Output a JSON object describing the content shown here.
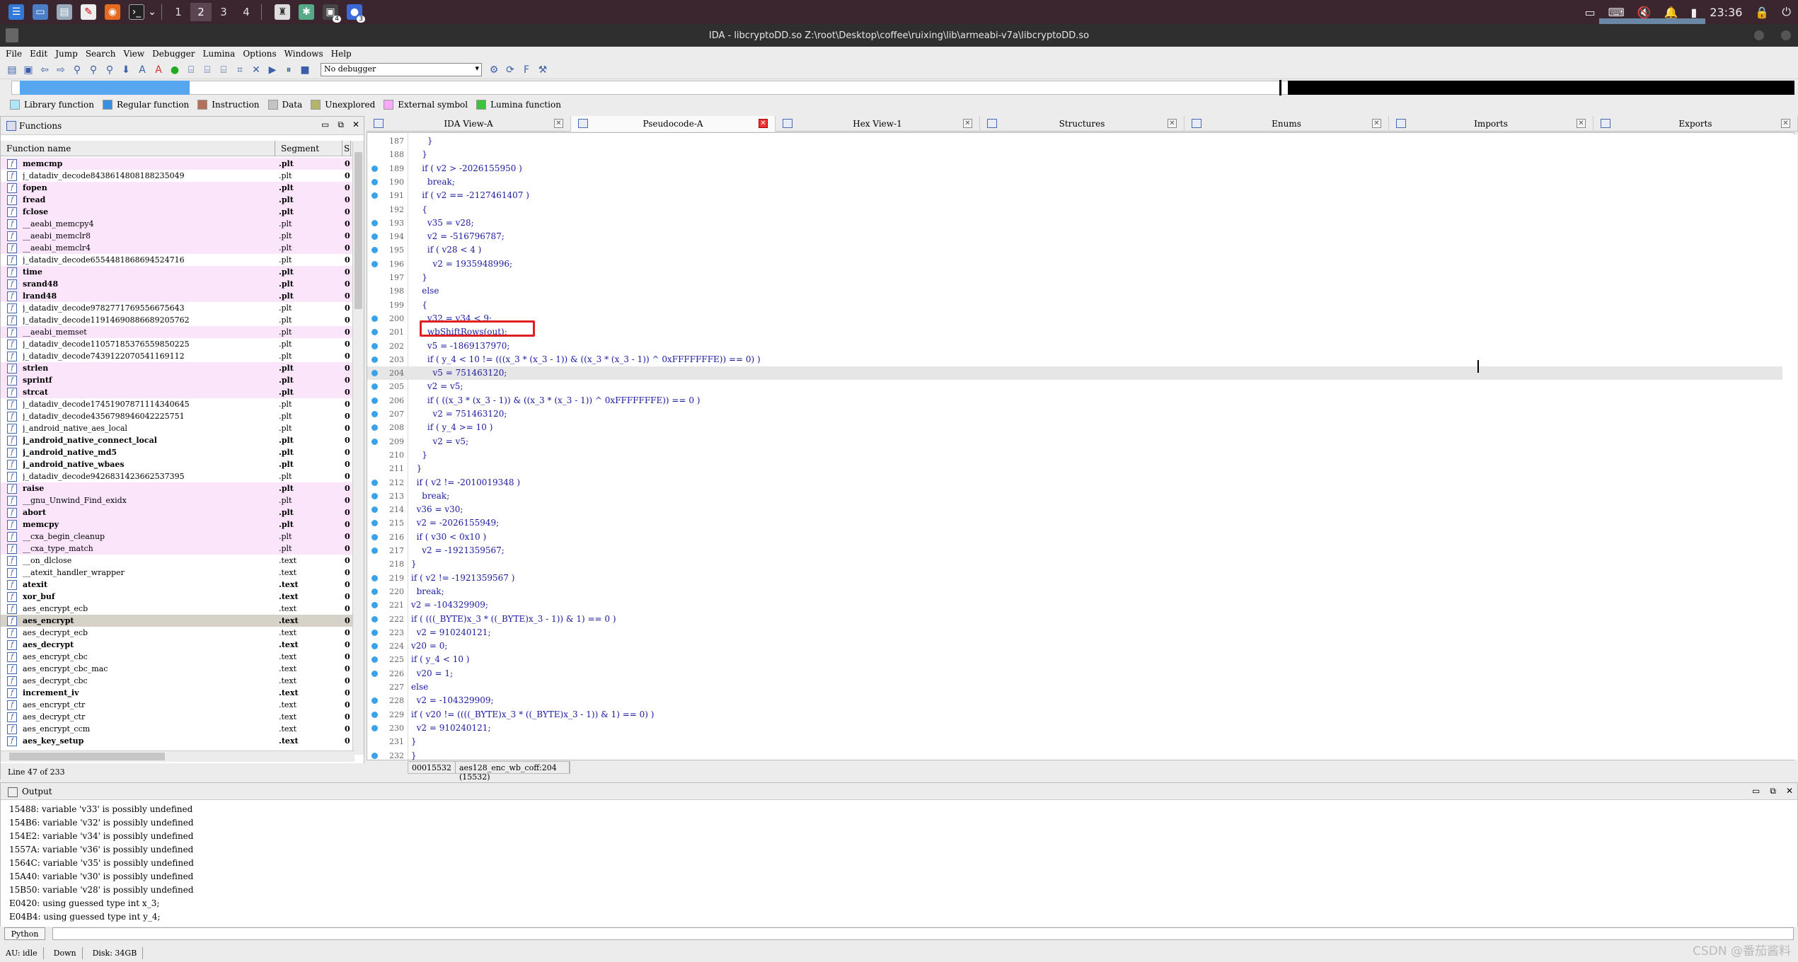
{
  "taskbar": {
    "workspaces": [
      "1",
      "2",
      "3",
      "4"
    ],
    "active_workspace": "2",
    "clock": "23:36",
    "badge1": "4",
    "badge2": "3"
  },
  "window": {
    "title": "IDA - libcryptoDD.so Z:\\root\\Desktop\\coffee\\ruixing\\lib\\armeabi-v7a\\libcryptoDD.so"
  },
  "menu": [
    "File",
    "Edit",
    "Jump",
    "Search",
    "View",
    "Debugger",
    "Lumina",
    "Options",
    "Windows",
    "Help"
  ],
  "toolbar": {
    "debugger_value": "No debugger"
  },
  "legend": [
    {
      "label": "Library function",
      "color": "#aee6f7"
    },
    {
      "label": "Regular function",
      "color": "#3a8ee0"
    },
    {
      "label": "Instruction",
      "color": "#b0705a"
    },
    {
      "label": "Data",
      "color": "#c4c4c4"
    },
    {
      "label": "Unexplored",
      "color": "#b4b46a"
    },
    {
      "label": "External symbol",
      "color": "#f7a8f7"
    },
    {
      "label": "Lumina function",
      "color": "#3cc43c"
    }
  ],
  "functions": {
    "title": "Functions",
    "col_name": "Function name",
    "col_segment": "Segment",
    "col_s": "S",
    "rows": [
      {
        "name": "memcmp",
        "seg": ".plt",
        "v": "0",
        "bold": true,
        "lib": true
      },
      {
        "name": "j_datadiv_decode8438614808188235049",
        "seg": ".plt",
        "v": "0",
        "bold": false,
        "lib": false
      },
      {
        "name": "fopen",
        "seg": ".plt",
        "v": "0",
        "bold": true,
        "lib": true
      },
      {
        "name": "fread",
        "seg": ".plt",
        "v": "0",
        "bold": true,
        "lib": true
      },
      {
        "name": "fclose",
        "seg": ".plt",
        "v": "0",
        "bold": true,
        "lib": true
      },
      {
        "name": "__aeabi_memcpy4",
        "seg": ".plt",
        "v": "0",
        "bold": false,
        "lib": true
      },
      {
        "name": "__aeabi_memclr8",
        "seg": ".plt",
        "v": "0",
        "bold": false,
        "lib": true
      },
      {
        "name": "__aeabi_memclr4",
        "seg": ".plt",
        "v": "0",
        "bold": false,
        "lib": true
      },
      {
        "name": "j_datadiv_decode6554481868694524716",
        "seg": ".plt",
        "v": "0",
        "bold": false,
        "lib": false
      },
      {
        "name": "time",
        "seg": ".plt",
        "v": "0",
        "bold": true,
        "lib": true
      },
      {
        "name": "srand48",
        "seg": ".plt",
        "v": "0",
        "bold": true,
        "lib": true
      },
      {
        "name": "lrand48",
        "seg": ".plt",
        "v": "0",
        "bold": true,
        "lib": true
      },
      {
        "name": "j_datadiv_decode9782771769556675643",
        "seg": ".plt",
        "v": "0",
        "bold": false,
        "lib": false
      },
      {
        "name": "j_datadiv_decode11914690886689205762",
        "seg": ".plt",
        "v": "0",
        "bold": false,
        "lib": false
      },
      {
        "name": "__aeabi_memset",
        "seg": ".plt",
        "v": "0",
        "bold": false,
        "lib": true
      },
      {
        "name": "j_datadiv_decode11057185376559850225",
        "seg": ".plt",
        "v": "0",
        "bold": false,
        "lib": false
      },
      {
        "name": "j_datadiv_decode7439122070541169112",
        "seg": ".plt",
        "v": "0",
        "bold": false,
        "lib": false
      },
      {
        "name": "strlen",
        "seg": ".plt",
        "v": "0",
        "bold": true,
        "lib": true
      },
      {
        "name": "sprintf",
        "seg": ".plt",
        "v": "0",
        "bold": true,
        "lib": true
      },
      {
        "name": "strcat",
        "seg": ".plt",
        "v": "0",
        "bold": true,
        "lib": true
      },
      {
        "name": "j_datadiv_decode17451907871114340645",
        "seg": ".plt",
        "v": "0",
        "bold": false,
        "lib": false
      },
      {
        "name": "j_datadiv_decode4356798946042225751",
        "seg": ".plt",
        "v": "0",
        "bold": false,
        "lib": false
      },
      {
        "name": "j_android_native_aes_local",
        "seg": ".plt",
        "v": "0",
        "bold": false,
        "lib": false
      },
      {
        "name": "j_android_native_connect_local",
        "seg": ".plt",
        "v": "0",
        "bold": true,
        "lib": false
      },
      {
        "name": "j_android_native_md5",
        "seg": ".plt",
        "v": "0",
        "bold": true,
        "lib": false
      },
      {
        "name": "j_android_native_wbaes",
        "seg": ".plt",
        "v": "0",
        "bold": true,
        "lib": false
      },
      {
        "name": "j_datadiv_decode9426831423662537395",
        "seg": ".plt",
        "v": "0",
        "bold": false,
        "lib": false
      },
      {
        "name": "raise",
        "seg": ".plt",
        "v": "0",
        "bold": true,
        "lib": true
      },
      {
        "name": "__gnu_Unwind_Find_exidx",
        "seg": ".plt",
        "v": "0",
        "bold": false,
        "lib": true
      },
      {
        "name": "abort",
        "seg": ".plt",
        "v": "0",
        "bold": true,
        "lib": true
      },
      {
        "name": "memcpy",
        "seg": ".plt",
        "v": "0",
        "bold": true,
        "lib": true
      },
      {
        "name": "__cxa_begin_cleanup",
        "seg": ".plt",
        "v": "0",
        "bold": false,
        "lib": true
      },
      {
        "name": "__cxa_type_match",
        "seg": ".plt",
        "v": "0",
        "bold": false,
        "lib": true
      },
      {
        "name": "__on_dlclose",
        "seg": ".text",
        "v": "0",
        "bold": false,
        "lib": false
      },
      {
        "name": "__atexit_handler_wrapper",
        "seg": ".text",
        "v": "0",
        "bold": false,
        "lib": false
      },
      {
        "name": "atexit",
        "seg": ".text",
        "v": "0",
        "bold": true,
        "lib": false
      },
      {
        "name": "xor_buf",
        "seg": ".text",
        "v": "0",
        "bold": true,
        "lib": false
      },
      {
        "name": "aes_encrypt_ecb",
        "seg": ".text",
        "v": "0",
        "bold": false,
        "lib": false
      },
      {
        "name": "aes_encrypt",
        "seg": ".text",
        "v": "0",
        "bold": true,
        "lib": false,
        "sel": true
      },
      {
        "name": "aes_decrypt_ecb",
        "seg": ".text",
        "v": "0",
        "bold": false,
        "lib": false
      },
      {
        "name": "aes_decrypt",
        "seg": ".text",
        "v": "0",
        "bold": true,
        "lib": false
      },
      {
        "name": "aes_encrypt_cbc",
        "seg": ".text",
        "v": "0",
        "bold": false,
        "lib": false
      },
      {
        "name": "aes_encrypt_cbc_mac",
        "seg": ".text",
        "v": "0",
        "bold": false,
        "lib": false
      },
      {
        "name": "aes_decrypt_cbc",
        "seg": ".text",
        "v": "0",
        "bold": false,
        "lib": false
      },
      {
        "name": "increment_iv",
        "seg": ".text",
        "v": "0",
        "bold": true,
        "lib": false
      },
      {
        "name": "aes_encrypt_ctr",
        "seg": ".text",
        "v": "0",
        "bold": false,
        "lib": false
      },
      {
        "name": "aes_decrypt_ctr",
        "seg": ".text",
        "v": "0",
        "bold": false,
        "lib": false
      },
      {
        "name": "aes_encrypt_ccm",
        "seg": ".text",
        "v": "0",
        "bold": false,
        "lib": false
      },
      {
        "name": "aes_key_setup",
        "seg": ".text",
        "v": "0",
        "bold": true,
        "lib": false
      }
    ],
    "status": "Line 47 of 233"
  },
  "tabs": [
    {
      "label": "IDA View-A",
      "active": false,
      "close_red": false
    },
    {
      "label": "Pseudocode-A",
      "active": true,
      "close_red": true
    },
    {
      "label": "Hex View-1",
      "active": false,
      "close_red": false
    },
    {
      "label": "Structures",
      "active": false,
      "close_red": false
    },
    {
      "label": "Enums",
      "active": false,
      "close_red": false
    },
    {
      "label": "Imports",
      "active": false,
      "close_red": false
    },
    {
      "label": "Exports",
      "active": false,
      "close_red": false
    }
  ],
  "code": [
    {
      "n": "187",
      "t": "      }",
      "dot": false
    },
    {
      "n": "188",
      "t": "    }",
      "dot": false
    },
    {
      "n": "189",
      "t": "    if ( v2 > -2026155950 )",
      "dot": true
    },
    {
      "n": "190",
      "t": "      break;",
      "dot": true
    },
    {
      "n": "191",
      "t": "    if ( v2 == -2127461407 )",
      "dot": true
    },
    {
      "n": "192",
      "t": "    {",
      "dot": false
    },
    {
      "n": "193",
      "t": "      v35 = v28;",
      "dot": true
    },
    {
      "n": "194",
      "t": "      v2 = -516796787;",
      "dot": true
    },
    {
      "n": "195",
      "t": "      if ( v28 < 4 )",
      "dot": true
    },
    {
      "n": "196",
      "t": "        v2 = 1935948996;",
      "dot": true
    },
    {
      "n": "197",
      "t": "    }",
      "dot": false
    },
    {
      "n": "198",
      "t": "    else",
      "dot": false
    },
    {
      "n": "199",
      "t": "    {",
      "dot": false
    },
    {
      "n": "200",
      "t": "      v32 = v34 < 9;",
      "dot": true
    },
    {
      "n": "201",
      "t": "      wbShiftRows(out);",
      "dot": true
    },
    {
      "n": "202",
      "t": "      v5 = -1869137970;",
      "dot": true
    },
    {
      "n": "203",
      "t": "      if ( y_4 < 10 != (((x_3 * (x_3 - 1)) & ((x_3 * (x_3 - 1)) ^ 0xFFFFFFFE)) == 0) )",
      "dot": true
    },
    {
      "n": "204",
      "t": "        v5 = 751463120;",
      "dot": true,
      "hl": true
    },
    {
      "n": "205",
      "t": "      v2 = v5;",
      "dot": true
    },
    {
      "n": "206",
      "t": "      if ( ((x_3 * (x_3 - 1)) & ((x_3 * (x_3 - 1)) ^ 0xFFFFFFFE)) == 0 )",
      "dot": true
    },
    {
      "n": "207",
      "t": "        v2 = 751463120;",
      "dot": true
    },
    {
      "n": "208",
      "t": "      if ( y_4 >= 10 )",
      "dot": true
    },
    {
      "n": "209",
      "t": "        v2 = v5;",
      "dot": true
    },
    {
      "n": "210",
      "t": "    }",
      "dot": false
    },
    {
      "n": "211",
      "t": "  }",
      "dot": false
    },
    {
      "n": "212",
      "t": "  if ( v2 != -2010019348 )",
      "dot": true
    },
    {
      "n": "213",
      "t": "    break;",
      "dot": true
    },
    {
      "n": "214",
      "t": "  v36 = v30;",
      "dot": true
    },
    {
      "n": "215",
      "t": "  v2 = -2026155949;",
      "dot": true
    },
    {
      "n": "216",
      "t": "  if ( v30 < 0x10 )",
      "dot": true
    },
    {
      "n": "217",
      "t": "    v2 = -1921359567;",
      "dot": true
    },
    {
      "n": "218",
      "t": "}",
      "dot": false
    },
    {
      "n": "219",
      "t": "if ( v2 != -1921359567 )",
      "dot": true
    },
    {
      "n": "220",
      "t": "  break;",
      "dot": true
    },
    {
      "n": "221",
      "t": "v2 = -104329909;",
      "dot": true
    },
    {
      "n": "222",
      "t": "if ( (((_BYTE)x_3 * ((_BYTE)x_3 - 1)) & 1) == 0 )",
      "dot": true
    },
    {
      "n": "223",
      "t": "  v2 = 910240121;",
      "dot": true
    },
    {
      "n": "224",
      "t": "v20 = 0;",
      "dot": true
    },
    {
      "n": "225",
      "t": "if ( y_4 < 10 )",
      "dot": true
    },
    {
      "n": "226",
      "t": "  v20 = 1;",
      "dot": true
    },
    {
      "n": "227",
      "t": "else",
      "dot": false
    },
    {
      "n": "228",
      "t": "  v2 = -104329909;",
      "dot": true
    },
    {
      "n": "229",
      "t": "if ( v20 != ((((_BYTE)x_3 * ((_BYTE)x_3 - 1)) & 1) == 0) )",
      "dot": true
    },
    {
      "n": "230",
      "t": "  v2 = 910240121;",
      "dot": true
    },
    {
      "n": "231",
      "t": "}",
      "dot": false
    },
    {
      "n": "232",
      "t": "}",
      "dot": true
    }
  ],
  "code_status": {
    "addr": "00015532",
    "func": "aes128_enc_wb_coff:204 (15532)"
  },
  "output": {
    "title": "Output",
    "lines": [
      "15488: variable 'v33' is possibly undefined",
      "154B6: variable 'v32' is possibly undefined",
      "154E2: variable 'v34' is possibly undefined",
      "1557A: variable 'v36' is possibly undefined",
      "1564C: variable 'v35' is possibly undefined",
      "15A40: variable 'v30' is possibly undefined",
      "15B50: variable 'v28' is possibly undefined",
      "E0420: using guessed type int x_3;",
      "E04B4: using guessed type int y_4;"
    ],
    "python_label": "Python"
  },
  "status": {
    "au": "AU:  idle",
    "dir": "Down",
    "disk": "Disk: 34GB"
  },
  "watermark": "CSDN @番茄酱料"
}
